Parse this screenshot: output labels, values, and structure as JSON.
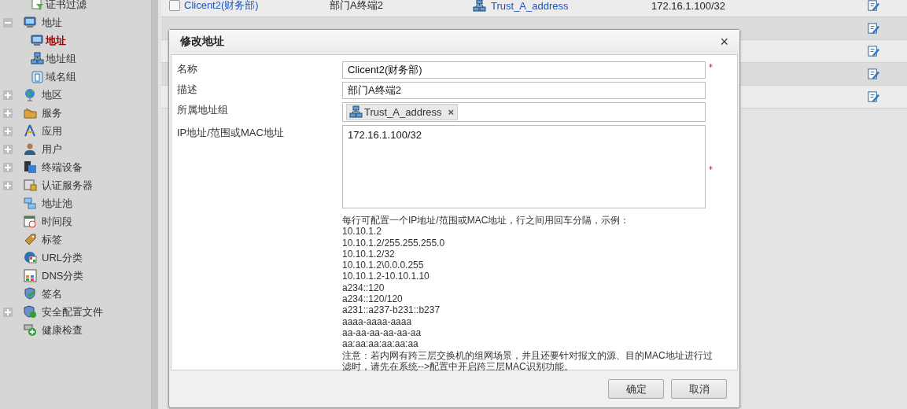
{
  "sidebar": {
    "tree": [
      {
        "children": [
          {
            "label": "证书过滤",
            "selected": false
          }
        ]
      },
      {
        "label": "地址",
        "expanded": true,
        "selected": false,
        "children": [
          {
            "label": "地址",
            "selected": true
          },
          {
            "label": "地址组",
            "selected": false
          },
          {
            "label": "域名组",
            "selected": false
          }
        ]
      },
      {
        "label": "地区",
        "expanded": false,
        "selected": false
      },
      {
        "label": "服务",
        "expanded": false,
        "selected": false
      },
      {
        "label": "应用",
        "expanded": false,
        "selected": false
      },
      {
        "label": "用户",
        "expanded": false,
        "selected": false
      },
      {
        "label": "终端设备",
        "expanded": false,
        "selected": false
      },
      {
        "label": "认证服务器",
        "expanded": false,
        "selected": false
      },
      {
        "label": "地址池",
        "selected": false
      },
      {
        "label": "时间段",
        "selected": false
      },
      {
        "label": "标签",
        "selected": false
      },
      {
        "label": "URL分类",
        "selected": false
      },
      {
        "label": "DNS分类",
        "selected": false
      },
      {
        "label": "签名",
        "selected": false
      },
      {
        "label": "安全配置文件",
        "expanded": false,
        "selected": false
      },
      {
        "label": "健康检查",
        "selected": false
      }
    ]
  },
  "table": {
    "rows": [
      {
        "kind": "full",
        "checked": false,
        "name": "Clicent2(财务部)",
        "description": "部门A终端2",
        "group": "Trust_A_address",
        "address": "172.16.1.100/32"
      },
      {
        "kind": "covered"
      },
      {
        "kind": "covered"
      },
      {
        "kind": "covered"
      },
      {
        "kind": "covered"
      }
    ]
  },
  "dialog": {
    "title": "修改地址",
    "close": "×",
    "fields": [
      {
        "kind": "text",
        "label": "名称",
        "value": "Clicent2(财务部)",
        "required": true
      },
      {
        "kind": "text",
        "label": "描述",
        "value": "部门A终端2"
      },
      {
        "kind": "tags",
        "label": "所属地址组",
        "tags": [
          {
            "label": "Trust_A_address",
            "remove": "×"
          }
        ]
      },
      {
        "kind": "textarea",
        "label": "IP地址/范围或MAC地址",
        "value": "172.16.1.100/32",
        "required": true
      }
    ],
    "help": {
      "intro": "每行可配置一个IP地址/范围或MAC地址，行之间用回车分隔，示例：",
      "examples": [
        "10.10.1.2",
        "10.10.1.2/255.255.255.0",
        "10.10.1.2/32",
        "10.10.1.2\\0.0.0.255",
        "10.10.1.2-10.10.1.10",
        "a234::120",
        "a234::120/120",
        "a231::a237-b231::b237",
        "aaaa-aaaa-aaaa",
        "aa-aa-aa-aa-aa-aa",
        "aa:aa:aa:aa:aa:aa"
      ],
      "note": "注意：若内网有跨三层交换机的组网场景，并且还要针对报文的源、目的MAC地址进行过滤时，请先在系统-->配置中开启跨三层MAC识别功能。"
    },
    "buttons": [
      "确定",
      "取消"
    ]
  }
}
